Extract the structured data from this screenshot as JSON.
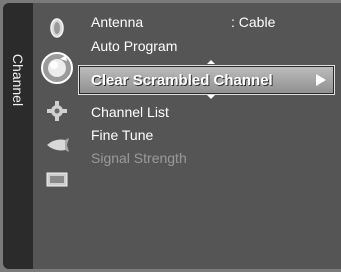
{
  "sidebar": {
    "title": "Channel"
  },
  "icons": [
    {
      "name": "picture-icon"
    },
    {
      "name": "channel-icon"
    },
    {
      "name": "setup-icon"
    },
    {
      "name": "input-icon"
    },
    {
      "name": "application-icon"
    }
  ],
  "menu": {
    "antenna": {
      "label": "Antenna",
      "value": ": Cable"
    },
    "auto_program": {
      "label": "Auto Program"
    },
    "clear_scrambled": {
      "label": "Clear Scrambled Channel"
    },
    "channel_list": {
      "label": "Channel List"
    },
    "fine_tune": {
      "label": "Fine Tune"
    },
    "signal_strength": {
      "label": "Signal Strength"
    }
  }
}
